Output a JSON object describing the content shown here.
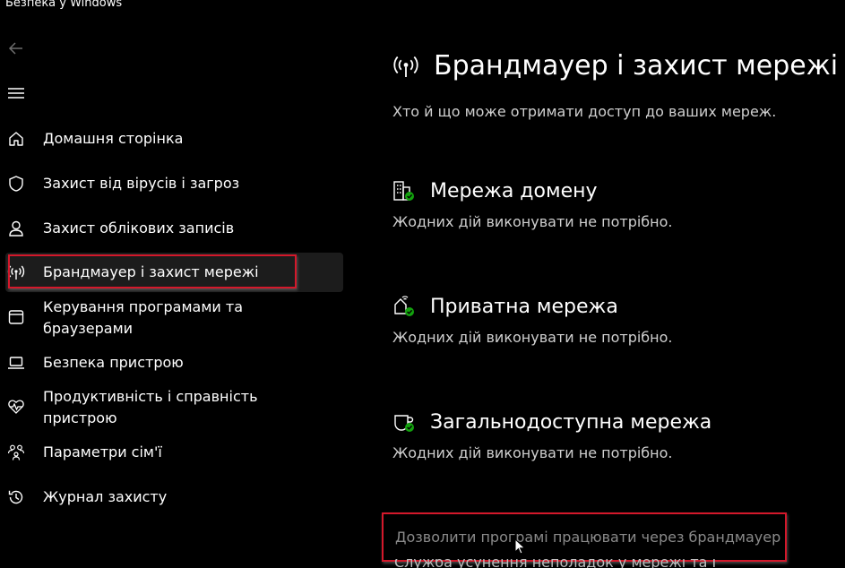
{
  "app": {
    "title": "Безпека у Windows"
  },
  "nav": {
    "back_icon": "back-arrow-icon",
    "menu_icon": "hamburger-menu-icon",
    "items": [
      {
        "label": "Домашня сторінка",
        "icon": "home-icon"
      },
      {
        "label": "Захист від вірусів і загроз",
        "icon": "shield-icon"
      },
      {
        "label": "Захист облікових записів",
        "icon": "person-icon"
      },
      {
        "label": "Брандмауер і захист мережі",
        "icon": "antenna-icon",
        "selected": true
      },
      {
        "label": "Керування програмами та браузерами",
        "icon": "app-window-icon"
      },
      {
        "label": "Безпека пристрою",
        "icon": "laptop-icon"
      },
      {
        "label": "Продуктивність і справність пристрою",
        "icon": "heart-pulse-icon"
      },
      {
        "label": "Параметри сім'ї",
        "icon": "family-icon"
      },
      {
        "label": "Журнал захисту",
        "icon": "history-icon"
      }
    ]
  },
  "main": {
    "title": "Брандмауер і захист мережі",
    "subtitle": "Хто й що може отримати доступ до ваших мереж.",
    "sections": [
      {
        "title": "Мережа домену",
        "status": "Жодних дій виконувати не потрібно.",
        "icon": "domain-network-icon"
      },
      {
        "title": "Приватна мережа",
        "status": "Жодних дій виконувати не потрібно.",
        "icon": "private-network-icon"
      },
      {
        "title": "Загальнодоступна мережа",
        "status": "Жодних дій виконувати не потрібно.",
        "icon": "public-network-icon"
      }
    ],
    "allow_link": "Дозволити програмі працювати через брандмауер",
    "next_link_partial": "Служба усунення неполадок у мережі та Інтернеті"
  },
  "colors": {
    "background": "#000000",
    "highlight": "#d4182b",
    "status_ok": "#13a10e"
  }
}
